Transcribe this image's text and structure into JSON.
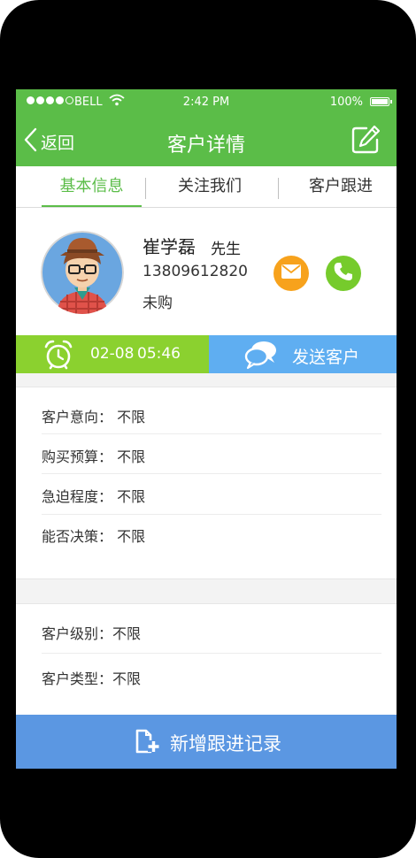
{
  "status_bar": {
    "carrier": "BELL",
    "time": "2:42 PM",
    "battery": "100%"
  },
  "nav": {
    "back_label": "返回",
    "title": "客户详情"
  },
  "tabs": [
    {
      "label": "基本信息",
      "active": true
    },
    {
      "label": "关注我们",
      "active": false
    },
    {
      "label": "客户跟进",
      "active": false
    }
  ],
  "customer": {
    "name": "崔学磊",
    "title": "先生",
    "phone": "13809612820",
    "status": "未购"
  },
  "reminder": {
    "date": "02-08",
    "time": "05:46"
  },
  "send": {
    "label": "发送客户"
  },
  "details": [
    {
      "label": "客户意向：",
      "value": "不限"
    },
    {
      "label": "购买预算：",
      "value": "不限"
    },
    {
      "label": "急迫程度：",
      "value": "不限"
    },
    {
      "label": "能否决策：",
      "value": "不限"
    }
  ],
  "details2": [
    {
      "label": "客户级别：",
      "value": "不限"
    },
    {
      "label": "客户类型：",
      "value": "不限"
    }
  ],
  "add_record": {
    "label": "新增跟进记录"
  },
  "colors": {
    "green": "#5bbd48",
    "lime": "#8bd12f",
    "blue": "#5faef1",
    "button_blue": "#5b97e2",
    "orange": "#f7a21c"
  }
}
